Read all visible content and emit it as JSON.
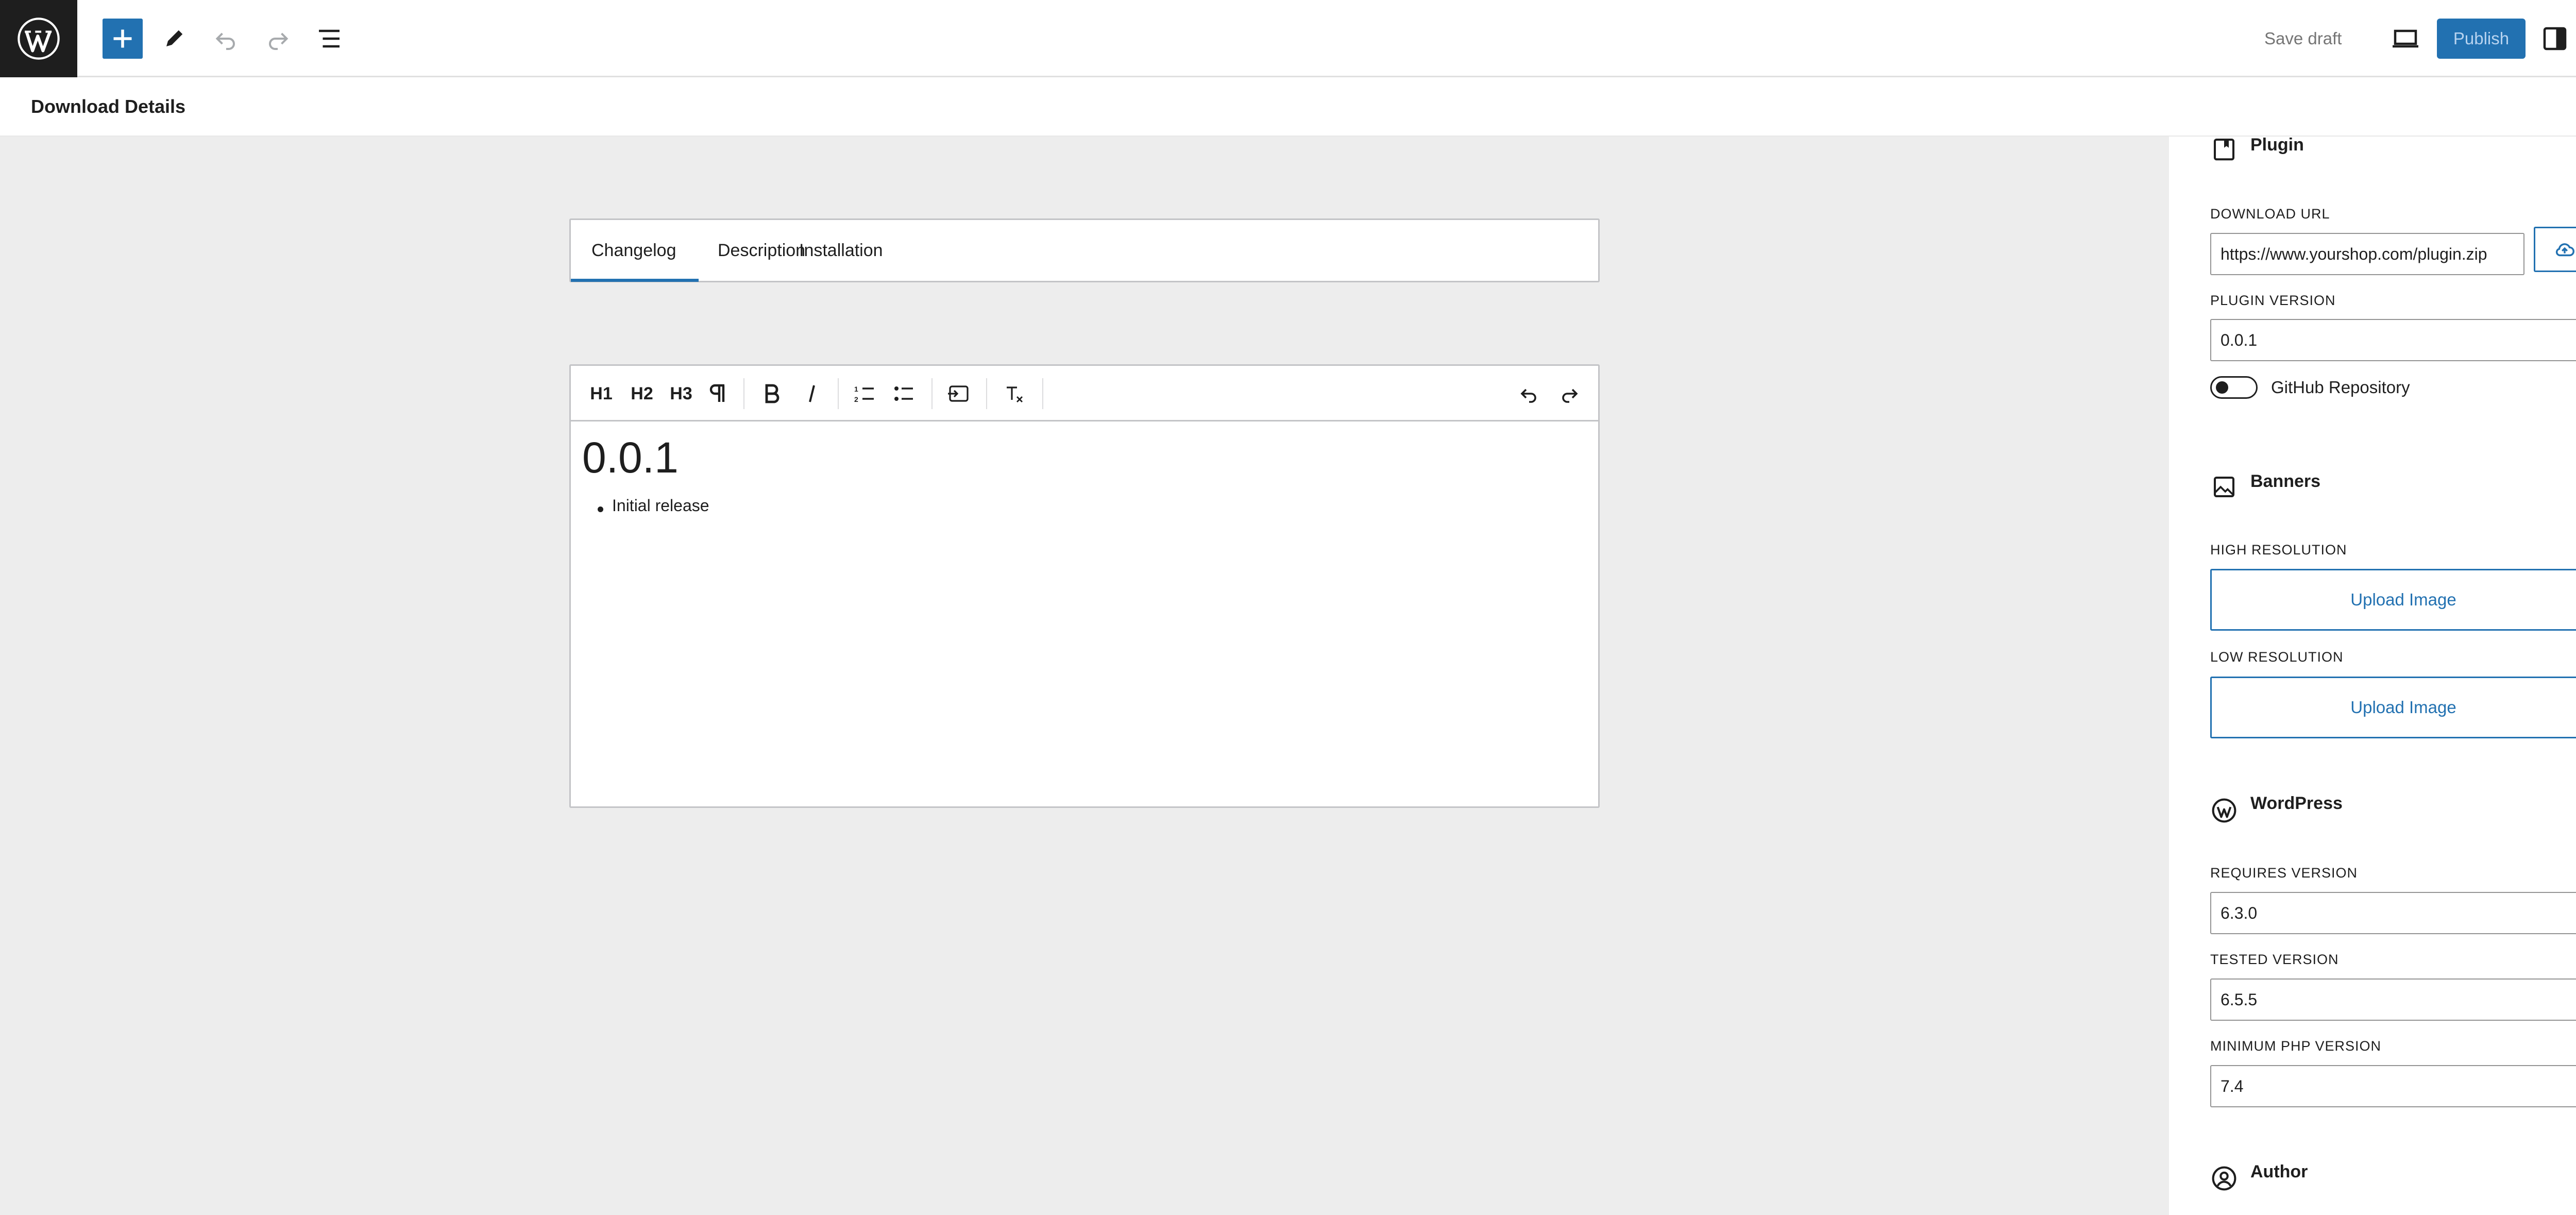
{
  "topbar": {
    "save_draft": "Save draft",
    "publish": "Publish",
    "accent": "#2271b1"
  },
  "metabox": {
    "title": "Download Details"
  },
  "tabs": [
    {
      "label": "Changelog",
      "active": true
    },
    {
      "label": "Description",
      "active": false
    },
    {
      "label": "Installation",
      "active": false
    }
  ],
  "editor": {
    "toolbar": {
      "h1": "H1",
      "h2": "H2",
      "h3": "H3"
    },
    "heading": "0.0.1",
    "list_items": [
      "Initial release"
    ]
  },
  "sidebar": {
    "plugin": {
      "title": "Plugin",
      "download_url_label": "DOWNLOAD URL",
      "download_url": "https://www.yourshop.com/plugin.zip",
      "version_label": "PLUGIN VERSION",
      "version": "0.0.1",
      "github_label": "GitHub Repository",
      "github_enabled": false
    },
    "banners": {
      "title": "Banners",
      "high_label": "HIGH RESOLUTION",
      "high_button": "Upload Image",
      "low_label": "LOW RESOLUTION",
      "low_button": "Upload Image"
    },
    "wordpress": {
      "title": "WordPress",
      "requires_label": "REQUIRES VERSION",
      "requires": "6.3.0",
      "tested_label": "TESTED VERSION",
      "tested": "6.5.5",
      "php_label": "MINIMUM PHP VERSION",
      "php": "7.4"
    },
    "author": {
      "title": "Author"
    }
  }
}
